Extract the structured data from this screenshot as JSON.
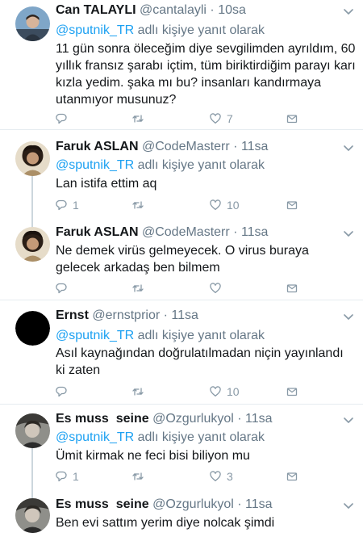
{
  "tweets": [
    {
      "name": "Can TALAYLI",
      "handle": "@cantalayli",
      "dot": "·",
      "time": "10sa",
      "reply_mention": "@sputnik_TR",
      "reply_suffix": " adlı kişiye yanıt olarak",
      "text": "11 gün sonra öleceğim diye sevgilimden ayrıldım, 60 yıllık fransız şarabı içtim, tüm biriktirdiğim parayı karı kızla yedim. şaka mı bu? insanları kandırmaya utanmıyor musunuz?",
      "reply_count": "",
      "retweet_count": "",
      "like_count": "7"
    },
    {
      "name": "Faruk ASLAN",
      "handle": "@CodeMasterr",
      "dot": "·",
      "time": "11sa",
      "reply_mention": "@sputnik_TR",
      "reply_suffix": " adlı kişiye yanıt olarak",
      "text": "Lan istifa ettim aq",
      "reply_count": "1",
      "retweet_count": "",
      "like_count": "10"
    },
    {
      "name": "Faruk ASLAN",
      "handle": "@CodeMasterr",
      "dot": "·",
      "time": "11sa",
      "text": "Ne demek virüs gelmeyecek. O virus buraya gelecek arkadaş ben bilmem",
      "reply_count": "",
      "retweet_count": "",
      "like_count": ""
    },
    {
      "name": "Ernst",
      "handle": "@ernstprior",
      "dot": "·",
      "time": "11sa",
      "reply_mention": "@sputnik_TR",
      "reply_suffix": " adlı kişiye yanıt olarak",
      "text": "Asıl kaynağından doğrulatılmadan niçin yayınlandı ki zaten",
      "reply_count": "",
      "retweet_count": "",
      "like_count": "10"
    },
    {
      "name": "Es muss  seine",
      "handle": "@Ozgurlukyol",
      "dot": "·",
      "time": "11sa",
      "reply_mention": "@sputnik_TR",
      "reply_suffix": " adlı kişiye yanıt olarak",
      "text": "Ümit kirmak ne feci bisi biliyon mu",
      "reply_count": "1",
      "retweet_count": "",
      "like_count": "3"
    },
    {
      "name": "Es muss  seine",
      "handle": "@Ozgurlukyol",
      "dot": "·",
      "time": "11sa",
      "text": "Ben evi sattım yerim diye nolcak şimdi"
    }
  ],
  "icons": {
    "reply": "reply-icon",
    "retweet": "retweet-icon",
    "like": "heart-icon",
    "dm": "envelope-icon",
    "caret": "chevron-down-icon"
  },
  "colors": {
    "link": "#1da1f2",
    "secondary_text": "#657786",
    "action_icons": "#8899a6",
    "divider": "#e6ecf0",
    "thread_line": "#ccd6dd"
  }
}
